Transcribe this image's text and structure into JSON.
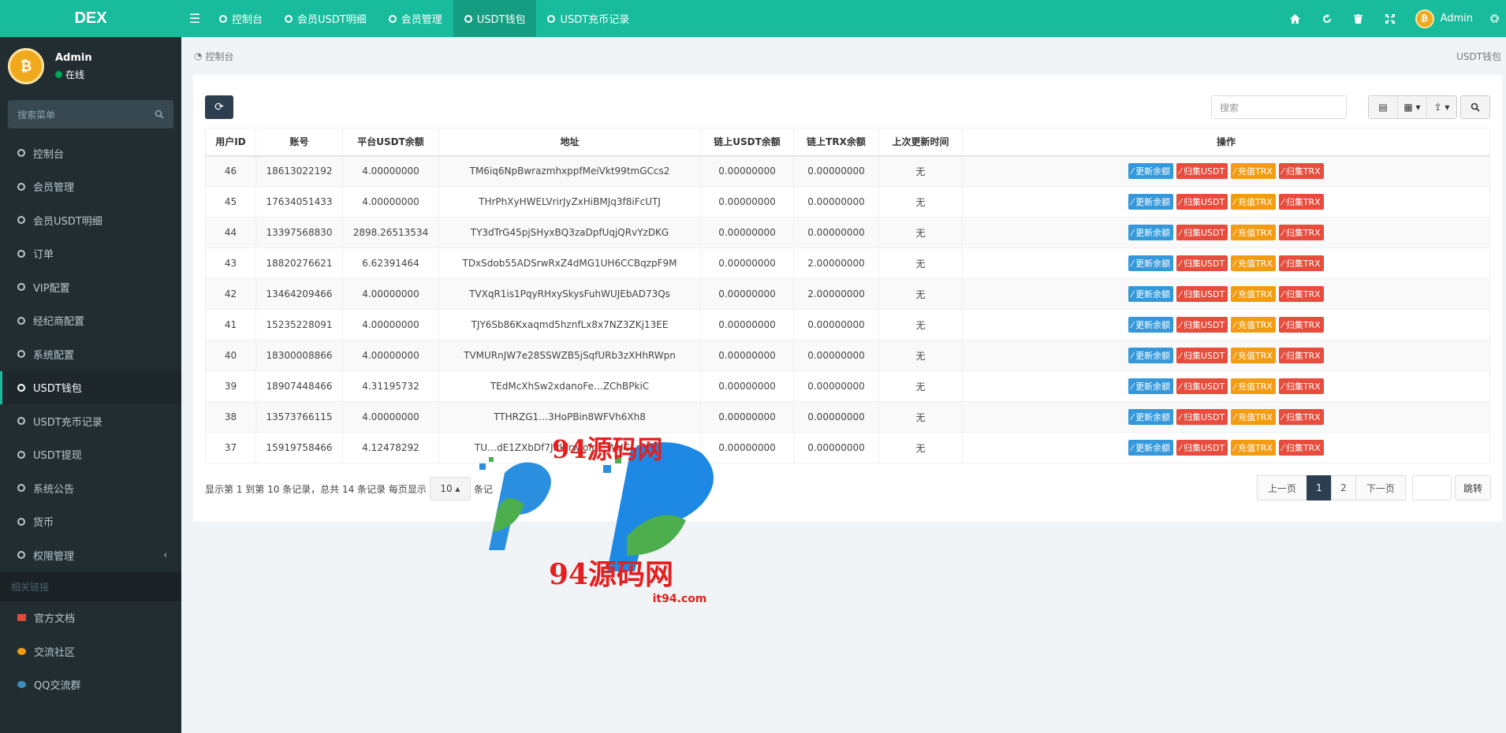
{
  "app": {
    "logo": "DEX"
  },
  "topbar": {
    "tabs": [
      {
        "label": "控制台"
      },
      {
        "label": "会员USDT明细"
      },
      {
        "label": "会员管理"
      },
      {
        "label": "USDT钱包"
      },
      {
        "label": "USDT充币记录"
      }
    ],
    "user": "Admin"
  },
  "sidebar": {
    "user": {
      "name": "Admin",
      "status": "在线"
    },
    "search_placeholder": "搜索菜单",
    "items": [
      {
        "label": "控制台"
      },
      {
        "label": "会员管理"
      },
      {
        "label": "会员USDT明细"
      },
      {
        "label": "订单"
      },
      {
        "label": "VIP配置"
      },
      {
        "label": "经纪商配置"
      },
      {
        "label": "系统配置"
      },
      {
        "label": "USDT钱包"
      },
      {
        "label": "USDT充币记录"
      },
      {
        "label": "USDT提现"
      },
      {
        "label": "系统公告"
      },
      {
        "label": "货币"
      },
      {
        "label": "权限管理"
      }
    ],
    "links_header": "相关链接",
    "links": [
      {
        "label": "官方文档",
        "color": "#dd4b39"
      },
      {
        "label": "交流社区",
        "color": "#f39c12"
      },
      {
        "label": "QQ交流群",
        "color": "#3c8dbc"
      }
    ]
  },
  "breadcrumb": {
    "left": "控制台",
    "right": "USDT钱包"
  },
  "toolbar": {
    "search_placeholder": "搜索"
  },
  "table": {
    "headers": [
      "用户ID",
      "账号",
      "平台USDT余额",
      "地址",
      "链上USDT余额",
      "链上TRX余额",
      "上次更新时间",
      "操作"
    ],
    "ops": [
      "更新余额",
      "归集USDT",
      "充值TRX",
      "归集TRX"
    ],
    "rows": [
      [
        "46",
        "18613022192",
        "4.00000000",
        "TM6iq6NpBwrazmhxppfMeiVkt99tmGCcs2",
        "0.00000000",
        "0.00000000",
        "无"
      ],
      [
        "45",
        "17634051433",
        "4.00000000",
        "THrPhXyHWELVrirJyZxHiBMJq3f8iFcUTJ",
        "0.00000000",
        "0.00000000",
        "无"
      ],
      [
        "44",
        "13397568830",
        "2898.26513534",
        "TY3dTrG45pjSHyxBQ3zaDpfUqjQRvYzDKG",
        "0.00000000",
        "0.00000000",
        "无"
      ],
      [
        "43",
        "18820276621",
        "6.62391464",
        "TDxSdob55ADSrwRxZ4dMG1UH6CCBqzpF9M",
        "0.00000000",
        "2.00000000",
        "无"
      ],
      [
        "42",
        "13464209466",
        "4.00000000",
        "TVXqR1is1PqyRHxySkysFuhWUJEbAD73Qs",
        "0.00000000",
        "2.00000000",
        "无"
      ],
      [
        "41",
        "15235228091",
        "4.00000000",
        "TJY6Sb86Kxaqmd5hznfLx8x7NZ3ZKj13EE",
        "0.00000000",
        "0.00000000",
        "无"
      ],
      [
        "40",
        "18300008866",
        "4.00000000",
        "TVMURnJW7e28SSWZB5jSqfURb3zXHhRWpn",
        "0.00000000",
        "0.00000000",
        "无"
      ],
      [
        "39",
        "18907448466",
        "4.31195732",
        "TEdMcXhSw2xdanoFe…ZChBPkiC",
        "0.00000000",
        "0.00000000",
        "无"
      ],
      [
        "38",
        "13573766115",
        "4.00000000",
        "TTHRZG1…3HoPBin8WFVh6Xh8",
        "0.00000000",
        "0.00000000",
        "无"
      ],
      [
        "37",
        "15919758466",
        "4.12478292",
        "TU…dE1ZXbDf7Jirkfrwjofo…WUC1pz2Y2",
        "0.00000000",
        "0.00000000",
        "无"
      ]
    ]
  },
  "pagination": {
    "info": "显示第 1 到第 10 条记录，总共 14 条记录 每页显示",
    "per_page": "10",
    "info_tail": "条记",
    "prev": "上一页",
    "pages": [
      "1",
      "2"
    ],
    "next": "下一页",
    "jump": "跳转"
  },
  "watermark": {
    "brand": "94源码网",
    "url": "it94.com",
    "sub": "I T 9 4 . C O M"
  }
}
